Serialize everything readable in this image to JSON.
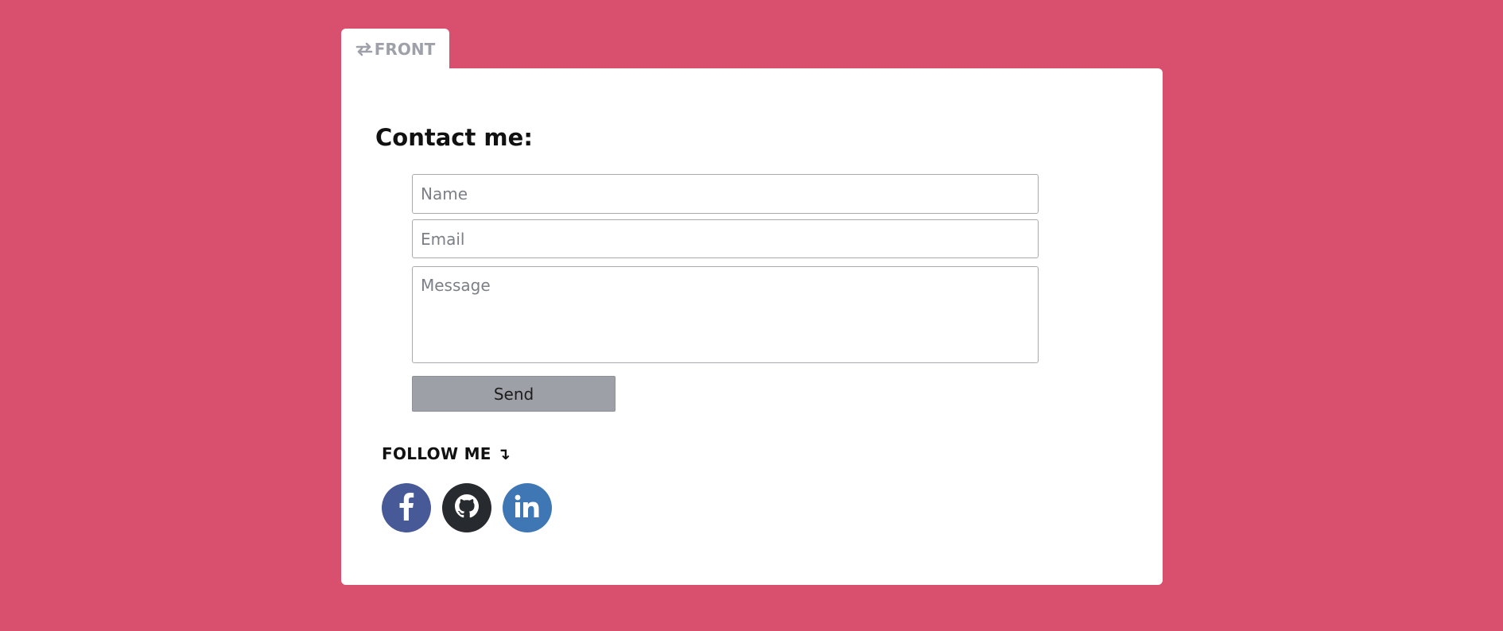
{
  "tab": {
    "label": "FRONT",
    "icon": "swap-arrows-icon"
  },
  "contact": {
    "title": "Contact me:",
    "name_placeholder": "Name",
    "email_placeholder": "Email",
    "message_placeholder": "Message",
    "send_label": "Send"
  },
  "follow": {
    "label": "FOLLOW ME ↴",
    "links": [
      {
        "name": "facebook",
        "icon": "facebook-icon",
        "color": "#475a97"
      },
      {
        "name": "github",
        "icon": "github-icon",
        "color": "#272a2e"
      },
      {
        "name": "linkedin",
        "icon": "linkedin-icon",
        "color": "#3f77b4"
      }
    ]
  },
  "colors": {
    "background": "#d9506e",
    "card": "#ffffff",
    "tab_text": "#9ea1a9",
    "send_button": "#9ea0a7"
  }
}
